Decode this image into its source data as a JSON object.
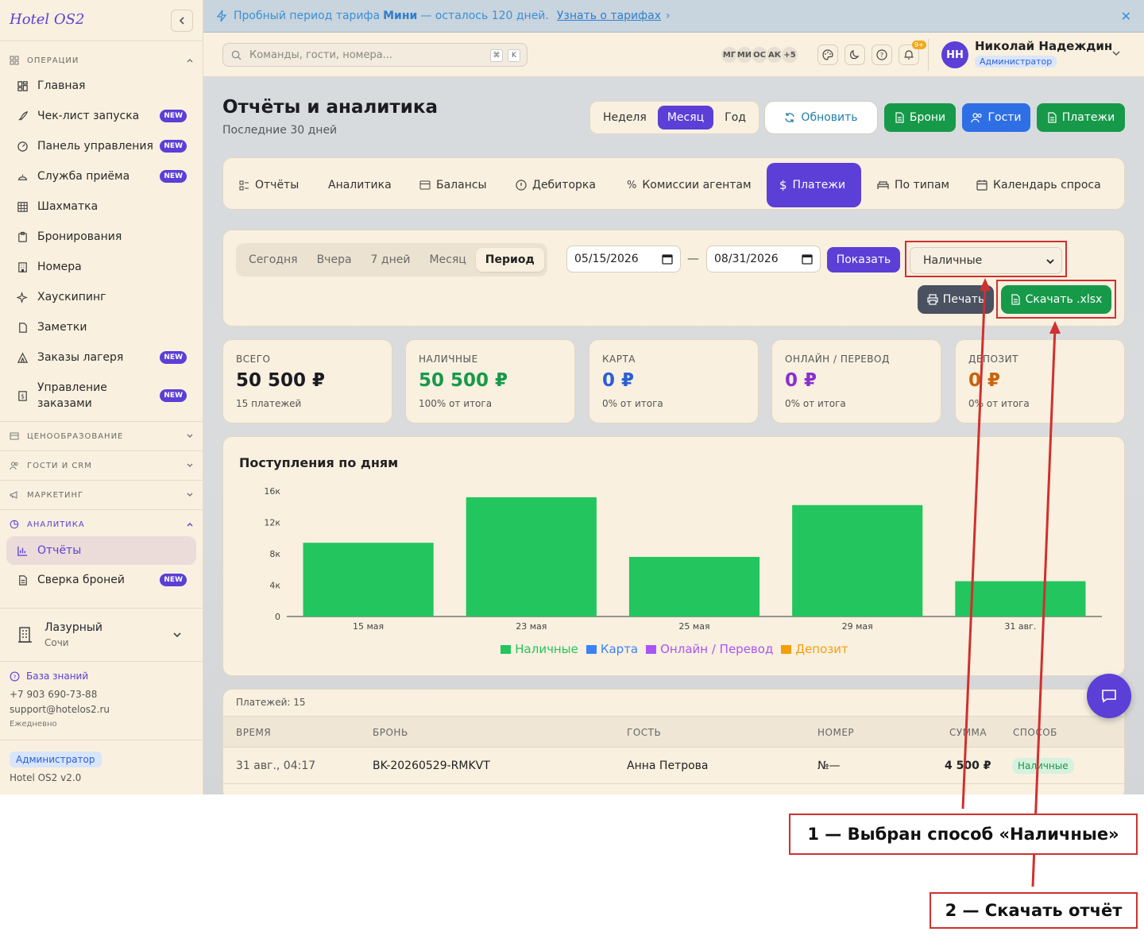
{
  "sidebar": {
    "logo": "Hotel OS2",
    "sections": {
      "ops": "ОПЕРАЦИИ",
      "pricing": "ЦЕНООБРАЗОВАНИЕ",
      "guests": "ГОСТИ И CRM",
      "marketing": "МАРКЕТИНГ",
      "analytics": "АНАЛИТИКА"
    },
    "badge": "NEW",
    "items": {
      "home": "Главная",
      "checklist": "Чек-лист запуска",
      "dashboard": "Панель управления",
      "frontdesk": "Служба приёма",
      "chess": "Шахматка",
      "bookings": "Бронирования",
      "rooms": "Номера",
      "housekeeping": "Хаускипинг",
      "notes": "Заметки",
      "camp": "Заказы лагеря",
      "orders": "Управление заказами",
      "reports": "Отчёты",
      "reconcile": "Сверка броней"
    },
    "hotel": {
      "name": "Лазурный",
      "city": "Сочи"
    },
    "support": {
      "kb": "База знаний",
      "phone": "+7 903 690-73-88",
      "email": "support@hotelos2.ru",
      "hours": "Ежедневно"
    },
    "role": "Администратор",
    "version": "Hotel OS2 v2.0"
  },
  "trial": {
    "pre": "Пробный период тарифа",
    "plan": "Мини",
    "post": "— осталось 120 дней.",
    "link": "Узнать о тарифах"
  },
  "topbar": {
    "search_placeholder": "Команды, гости, номера...",
    "kbd1": "⌘",
    "kbd2": "K",
    "avatars": [
      "МГ",
      "МИ",
      "ОС",
      "АК",
      "+5"
    ],
    "notif_count": "9+",
    "user_initials": "НН",
    "user_name": "Николай Надеждин",
    "user_role": "Администратор"
  },
  "page": {
    "title": "Отчёты и аналитика",
    "subtitle": "Последние 30 дней",
    "range": [
      "Неделя",
      "Месяц",
      "Год"
    ],
    "refresh": "Обновить",
    "actions": {
      "bookings": "Брони",
      "guests": "Гости",
      "payments": "Платежи"
    }
  },
  "tabs": [
    "Отчёты",
    "Аналитика",
    "Балансы",
    "Дебиторка",
    "Комиссии агентам",
    "Платежи",
    "По типам",
    "Календарь спроса"
  ],
  "filters": {
    "quick": [
      "Сегодня",
      "Вчера",
      "7 дней",
      "Месяц",
      "Период"
    ],
    "date_from": "05/15/2026",
    "date_to": "08/31/2026",
    "dash": "—",
    "show": "Показать",
    "method": "Наличные",
    "print": "Печать",
    "download": "Скачать .xlsx"
  },
  "cards": [
    {
      "label": "ВСЕГО",
      "value": "50 500 ₽",
      "sub": "15 платежей",
      "color": "#1b1b22"
    },
    {
      "label": "НАЛИЧНЫЕ",
      "value": "50 500 ₽",
      "sub": "100% от итога",
      "color": "#17994a"
    },
    {
      "label": "КАРТА",
      "value": "0 ₽",
      "sub": "0% от итога",
      "color": "#2c5fd4"
    },
    {
      "label": "ОНЛАЙН / ПЕРЕВОД",
      "value": "0 ₽",
      "sub": "0% от итога",
      "color": "#8a2fd1"
    },
    {
      "label": "ДЕПОЗИТ",
      "value": "0 ₽",
      "sub": "0% от итога",
      "color": "#c8630e"
    }
  ],
  "chart_data": {
    "type": "bar",
    "title": "Поступления по дням",
    "categories": [
      "15 мая",
      "23 мая",
      "25 мая",
      "29 мая",
      "31 авг."
    ],
    "series": [
      {
        "name": "Наличные",
        "color": "#22c55e",
        "values": [
          9400,
          15200,
          7600,
          14200,
          4500
        ]
      },
      {
        "name": "Карта",
        "color": "#3b82f6",
        "values": [
          0,
          0,
          0,
          0,
          0
        ]
      },
      {
        "name": "Онлайн / Перевод",
        "color": "#a855f7",
        "values": [
          0,
          0,
          0,
          0,
          0
        ]
      },
      {
        "name": "Депозит",
        "color": "#f59e0b",
        "values": [
          0,
          0,
          0,
          0,
          0
        ]
      }
    ],
    "yticks": [
      "0",
      "4к",
      "8к",
      "12к",
      "16к"
    ],
    "ytick_values": [
      0,
      4000,
      8000,
      12000,
      16000
    ],
    "ylim": [
      0,
      16000
    ],
    "legend": "bottom"
  },
  "table": {
    "count": "Платежей: 15",
    "headers": [
      "ВРЕМЯ",
      "БРОНЬ",
      "ГОСТЬ",
      "НОМЕР",
      "СУММА",
      "СПОСОБ"
    ],
    "rows": [
      {
        "time": "31 авг., 04:17",
        "booking": "BK-20260529-RMKVT",
        "guest": "Анна Петрова",
        "room": "№—",
        "amount": "4 500 ₽",
        "method": "Наличные"
      }
    ]
  },
  "annotations": {
    "callout1": "1 — Выбран способ «Наличные»",
    "callout2": "2 — Скачать отчёт",
    "color": "#d0302f"
  }
}
